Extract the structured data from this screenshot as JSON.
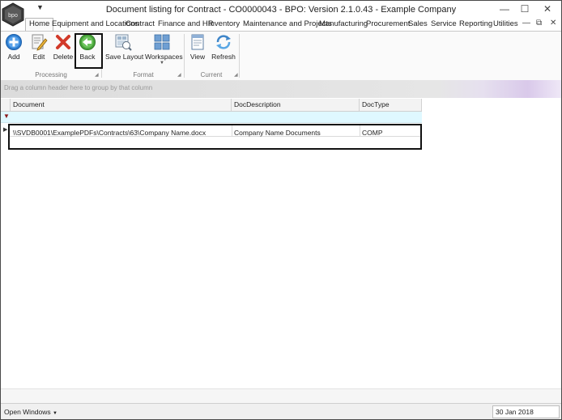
{
  "window": {
    "title": "Document listing for Contract - CO0000043 - BPO: Version 2.1.0.43 - Example Company",
    "quick_access_arrow": "▼",
    "minimize": "—",
    "maximize": "☐",
    "close": "✕",
    "logo_text": "bpo"
  },
  "tabs": [
    {
      "label": "Home",
      "active": true
    },
    {
      "label": "Equipment and Locations"
    },
    {
      "label": "Contract"
    },
    {
      "label": "Finance and HR"
    },
    {
      "label": "Inventory"
    },
    {
      "label": "Maintenance and Projects"
    },
    {
      "label": "Manufacturing"
    },
    {
      "label": "Procurement"
    },
    {
      "label": "Sales"
    },
    {
      "label": "Service"
    },
    {
      "label": "Reporting"
    },
    {
      "label": "Utilities"
    }
  ],
  "tab_controls": {
    "minimize_ribbon": "—",
    "restore": "⧉",
    "close": "✕"
  },
  "ribbon": {
    "processing": {
      "label": "Processing",
      "buttons": {
        "add": "Add",
        "edit": "Edit",
        "delete": "Delete",
        "back": "Back"
      }
    },
    "format": {
      "label": "Format",
      "buttons": {
        "save_layout": "Save Layout",
        "workspaces": "Workspaces"
      }
    },
    "current": {
      "label": "Current",
      "buttons": {
        "view": "View",
        "refresh": "Refresh"
      }
    }
  },
  "group_panel": {
    "hint": "Drag a column header here to group by that column"
  },
  "grid": {
    "columns": [
      "Document",
      "DocDescription",
      "DocType"
    ],
    "rows": [
      {
        "document": "\\\\SVDB0001\\ExamplePDFs\\Contracts\\63\\Company Name.docx",
        "description": "Company Name Documents",
        "type": "COMP"
      }
    ],
    "filter_icon": "▼",
    "row_indicator": "▶"
  },
  "status": {
    "open_windows": "Open Windows",
    "open_windows_arrow": "▼",
    "date": "30 Jan 2018"
  },
  "colors": {
    "accent_tab": "#fafafa",
    "filter_row": "#dff8ff",
    "add_icon": "#2f7fd1",
    "delete_icon": "#d23a2a",
    "back_icon": "#48a43a"
  }
}
